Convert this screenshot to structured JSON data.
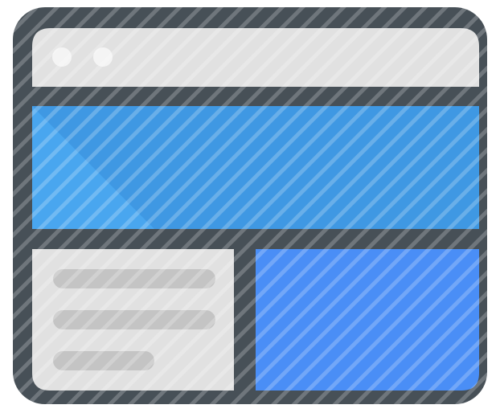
{
  "icon": {
    "name": "browser-window-layout-icon",
    "colors": {
      "frame": "#475057",
      "frame_highlight": "#5a646b",
      "titlebar": "#e1e1e1",
      "sidebar_panel": "#e1e1e1",
      "window_dot": "#f4f4f4",
      "text_line": "#c4c4c4",
      "hero_banner": "#49a6ef",
      "hero_banner_shade": "#3f98e3",
      "content_panel": "#4a8ef6",
      "stripe": "#ffffff",
      "background": "#ffffff"
    },
    "window_dots": 2,
    "sidebar_text_lines": 3
  }
}
